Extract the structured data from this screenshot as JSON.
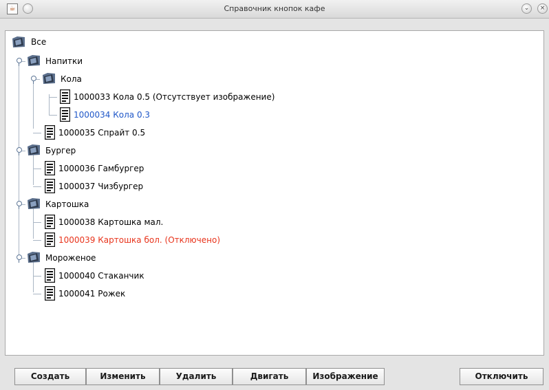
{
  "window": {
    "title": "Справочник кнопок кафе",
    "app_icon": "java-icon",
    "controls": [
      "window-menu-icon",
      "minimize-icon",
      "close-icon"
    ]
  },
  "tree": {
    "root": "Все",
    "groups": [
      {
        "label": "Напитки"
      },
      {
        "label": "Кола"
      },
      {
        "label": "Бургер"
      },
      {
        "label": "Картошка"
      },
      {
        "label": "Мороженое"
      }
    ],
    "items": [
      {
        "label": "1000033 Кола 0.5 (Отсутствует изображение)",
        "state": "normal"
      },
      {
        "label": "1000034 Кола 0.3",
        "state": "selected"
      },
      {
        "label": "1000035 Спрайт 0.5",
        "state": "normal"
      },
      {
        "label": "1000036 Гамбургер",
        "state": "normal"
      },
      {
        "label": "1000037 Чизбургер",
        "state": "normal"
      },
      {
        "label": "1000038 Картошка мал.",
        "state": "normal"
      },
      {
        "label": "1000039 Картошка бол. (Отключено)",
        "state": "disabled"
      },
      {
        "label": "1000040 Стаканчик",
        "state": "normal"
      },
      {
        "label": "1000041 Рожек",
        "state": "normal"
      }
    ],
    "colors": {
      "selected": "#1f57c8",
      "disabled": "#e8331b"
    }
  },
  "buttons": {
    "create": "Создать",
    "edit": "Изменить",
    "delete": "Удалить",
    "move": "Двигать",
    "image": "Изображение",
    "disable": "Отключить"
  }
}
